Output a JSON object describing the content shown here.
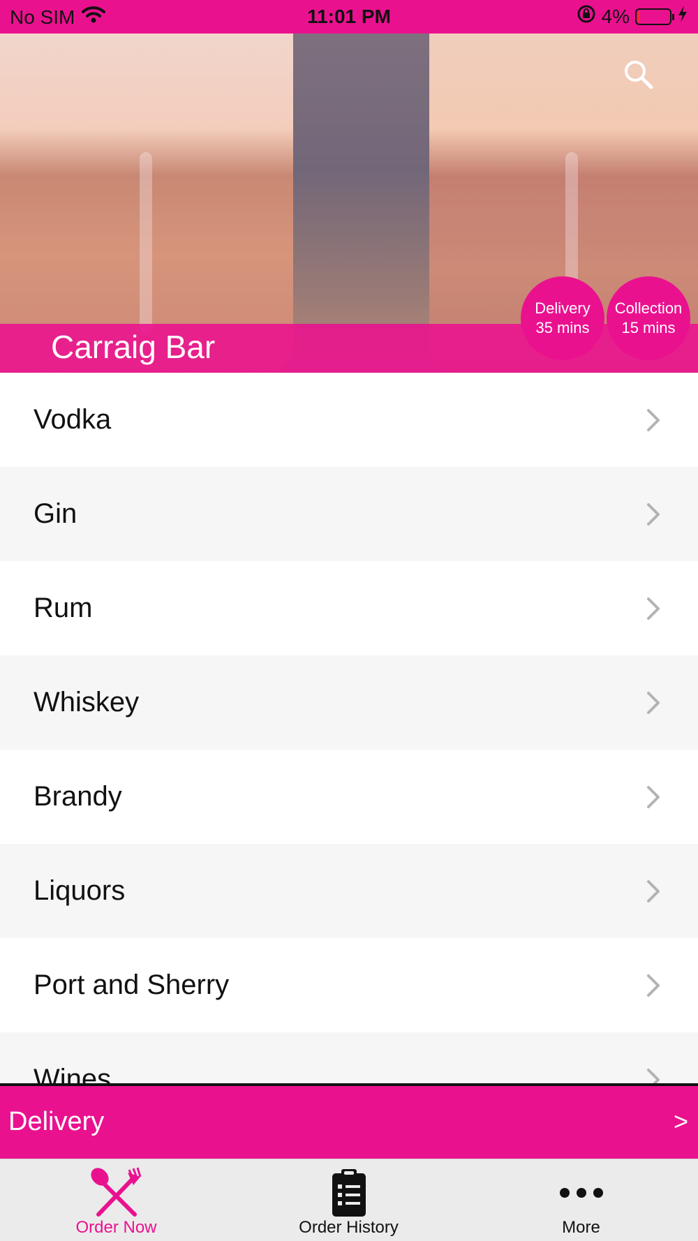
{
  "status_bar": {
    "carrier": "No SIM",
    "time": "11:01 PM",
    "battery_percent": "4%",
    "battery_level": 0.04
  },
  "hero": {
    "title": "Carraig Bar",
    "delivery_badge": {
      "label": "Delivery",
      "time": "35 mins"
    },
    "collection_badge": {
      "label": "Collection",
      "time": "15 mins"
    }
  },
  "menu": {
    "items": [
      {
        "label": "Vodka"
      },
      {
        "label": "Gin"
      },
      {
        "label": "Rum"
      },
      {
        "label": "Whiskey"
      },
      {
        "label": "Brandy"
      },
      {
        "label": "Liquors"
      },
      {
        "label": "Port and Sherry"
      },
      {
        "label": "Wines"
      }
    ]
  },
  "delivery_bar": {
    "label": "Delivery",
    "arrow": ">"
  },
  "tab_bar": {
    "tabs": [
      {
        "label": "Order Now",
        "active": true
      },
      {
        "label": "Order History",
        "active": false
      },
      {
        "label": "More",
        "active": false
      }
    ]
  },
  "colors": {
    "accent": "#ea118f",
    "tab_bar_bg": "#ebebeb",
    "row_alt_bg": "#f6f6f6"
  }
}
